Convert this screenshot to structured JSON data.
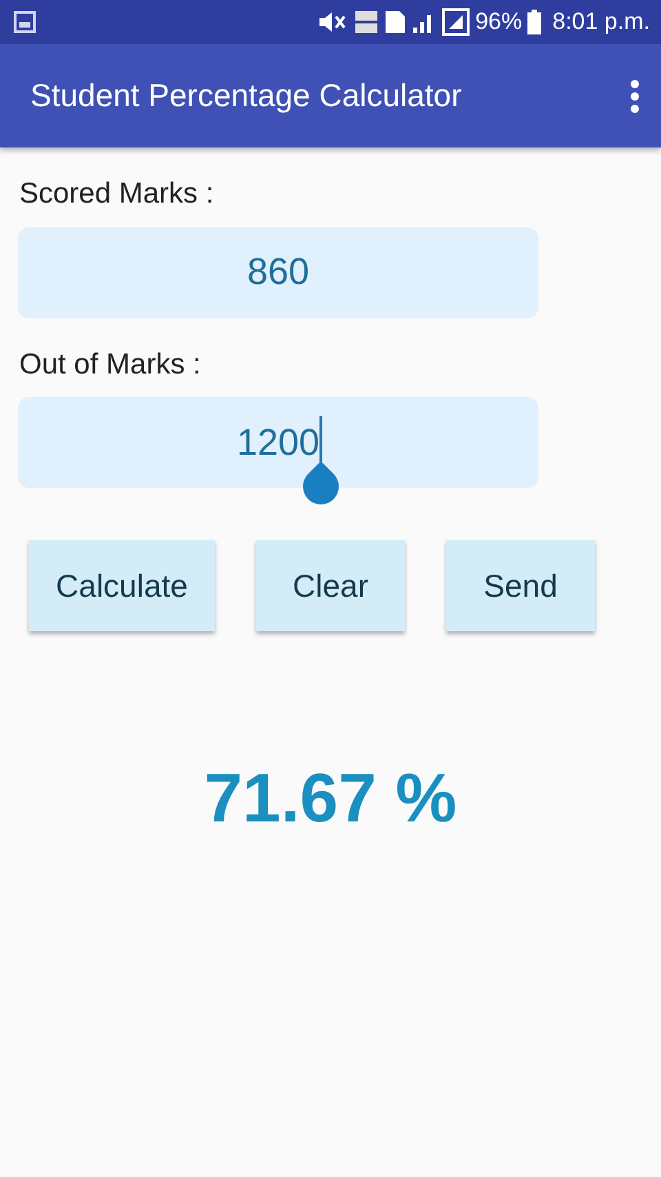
{
  "status_bar": {
    "battery": "96%",
    "time": "8:01 p.m."
  },
  "app_bar": {
    "title": "Student Percentage Calculator"
  },
  "fields": [
    {
      "label": "Scored Marks :",
      "value": "860",
      "focused": false
    },
    {
      "label": "Out of Marks  :",
      "value": "1200",
      "focused": true
    }
  ],
  "buttons": [
    "Calculate",
    "Clear",
    "Send"
  ],
  "result": "71.67 %"
}
